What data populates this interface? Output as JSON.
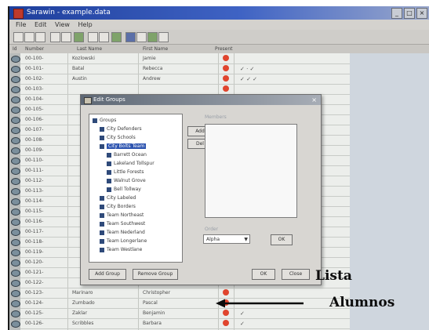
{
  "window": {
    "title": "Sarawin - example.data",
    "buttons": [
      "_",
      "□",
      "×"
    ]
  },
  "menu": [
    "File",
    "Edit",
    "View",
    "Help"
  ],
  "table": {
    "headers": [
      "Id",
      "Number",
      "Last Name",
      "First Name",
      "Present"
    ],
    "rows": [
      {
        "id": "00-100-",
        "last": "Kozlowski",
        "first": "Jamie",
        "checks": ""
      },
      {
        "id": "00-101-",
        "last": "Batal",
        "first": "Rebecca",
        "checks": "✓ · ✓"
      },
      {
        "id": "00-102-",
        "last": "Austin",
        "first": "Andrew",
        "checks": "✓ ✓ ✓"
      },
      {
        "id": "00-103-",
        "last": "",
        "first": "",
        "checks": ""
      },
      {
        "id": "00-104-",
        "last": "",
        "first": "",
        "checks": ""
      },
      {
        "id": "00-105-",
        "last": "",
        "first": "",
        "checks": ""
      },
      {
        "id": "00-106-",
        "last": "",
        "first": "",
        "checks": ""
      },
      {
        "id": "00-107-",
        "last": "",
        "first": "",
        "checks": "✓ ✓ ✓ ✓"
      },
      {
        "id": "00-108-",
        "last": "",
        "first": "",
        "checks": ""
      },
      {
        "id": "00-109-",
        "last": "",
        "first": "",
        "checks": ""
      },
      {
        "id": "00-110-",
        "last": "",
        "first": "",
        "checks": ""
      },
      {
        "id": "00-111-",
        "last": "",
        "first": "",
        "checks": ""
      },
      {
        "id": "00-112-",
        "last": "",
        "first": "",
        "checks": ""
      },
      {
        "id": "00-113-",
        "last": "",
        "first": "",
        "checks": ""
      },
      {
        "id": "00-114-",
        "last": "",
        "first": "",
        "checks": ""
      },
      {
        "id": "00-115-",
        "last": "",
        "first": "",
        "checks": ""
      },
      {
        "id": "00-116-",
        "last": "",
        "first": "",
        "checks": ""
      },
      {
        "id": "00-117-",
        "last": "",
        "first": "",
        "checks": ""
      },
      {
        "id": "00-118-",
        "last": "",
        "first": "",
        "checks": ""
      },
      {
        "id": "00-119-",
        "last": "",
        "first": "",
        "checks": ""
      },
      {
        "id": "00-120-",
        "last": "",
        "first": "",
        "checks": ""
      },
      {
        "id": "00-121-",
        "last": "",
        "first": "",
        "checks": ""
      },
      {
        "id": "00-122-",
        "last": "",
        "first": "",
        "checks": ""
      },
      {
        "id": "00-123-",
        "last": "Marinaro",
        "first": "Christopher",
        "checks": ""
      },
      {
        "id": "00-124-",
        "last": "Zumbado",
        "first": "Pascal",
        "checks": ""
      },
      {
        "id": "00-125-",
        "last": "Zaklar",
        "first": "Benjamin",
        "checks": "✓"
      },
      {
        "id": "00-126-",
        "last": "Scribbles",
        "first": "Barbara",
        "checks": "✓"
      }
    ]
  },
  "dialog": {
    "title": "Edit Groups",
    "tree": [
      {
        "label": "Groups",
        "level": 0
      },
      {
        "label": "City Defenders",
        "level": 1
      },
      {
        "label": "City Schools",
        "level": 1
      },
      {
        "label": "City Bolts Team",
        "level": 1,
        "selected": true
      },
      {
        "label": "Barrett Ocean",
        "level": 2
      },
      {
        "label": "Lakeland Tollspur",
        "level": 2
      },
      {
        "label": "Little Forests",
        "level": 2
      },
      {
        "label": "Walnut Grove",
        "level": 2
      },
      {
        "label": "Bell Tollway",
        "level": 2
      },
      {
        "label": "City Labeled",
        "level": 1
      },
      {
        "label": "City Borders",
        "level": 1
      },
      {
        "label": "Team Northeast",
        "level": 1
      },
      {
        "label": "Team Southwest",
        "level": 1
      },
      {
        "label": "Team Nederland",
        "level": 1
      },
      {
        "label": "Team Longerlane",
        "level": 1
      },
      {
        "label": "Team Westlane",
        "level": 1
      }
    ],
    "add_label": "Add",
    "remove_label": "Del",
    "members_label": "Members",
    "order_label": "Order",
    "order_value": "Alpha",
    "ok_small": "OK",
    "add_group": "Add Group",
    "remove_group": "Remove Group",
    "ok": "OK",
    "cancel": "Close"
  },
  "annotation": {
    "line1": "Lista",
    "line2": "Alumnos"
  }
}
